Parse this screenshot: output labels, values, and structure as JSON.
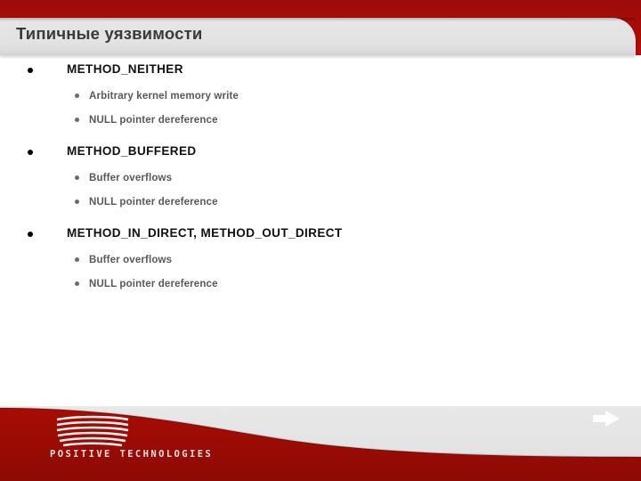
{
  "slide": {
    "title": "Типичные уязвимости",
    "theme": {
      "red": "#a80c06",
      "red_dark": "#8e0a05",
      "bar_gray": "#e3e3e3",
      "title_color": "#3a3a3a",
      "level1_color": "#111111",
      "level2_color": "#595959"
    },
    "groups": [
      {
        "heading": "METHOD_NEITHER",
        "items": [
          "Arbitrary kernel memory write",
          "NULL pointer dereference"
        ]
      },
      {
        "heading": "METHOD_BUFFERED",
        "items": [
          "Buffer overflows",
          "NULL pointer dereference"
        ]
      },
      {
        "heading": "METHOD_IN_DIRECT, METHOD_OUT_DIRECT",
        "items": [
          "Buffer overflows",
          "NULL pointer dereference"
        ]
      }
    ],
    "footer": {
      "logo_wordmark": "POSITIVE TECHNOLOGIES",
      "logo_mark_icon": "striped-curve-logo-icon",
      "next_icon": "next-arrow-icon"
    }
  }
}
